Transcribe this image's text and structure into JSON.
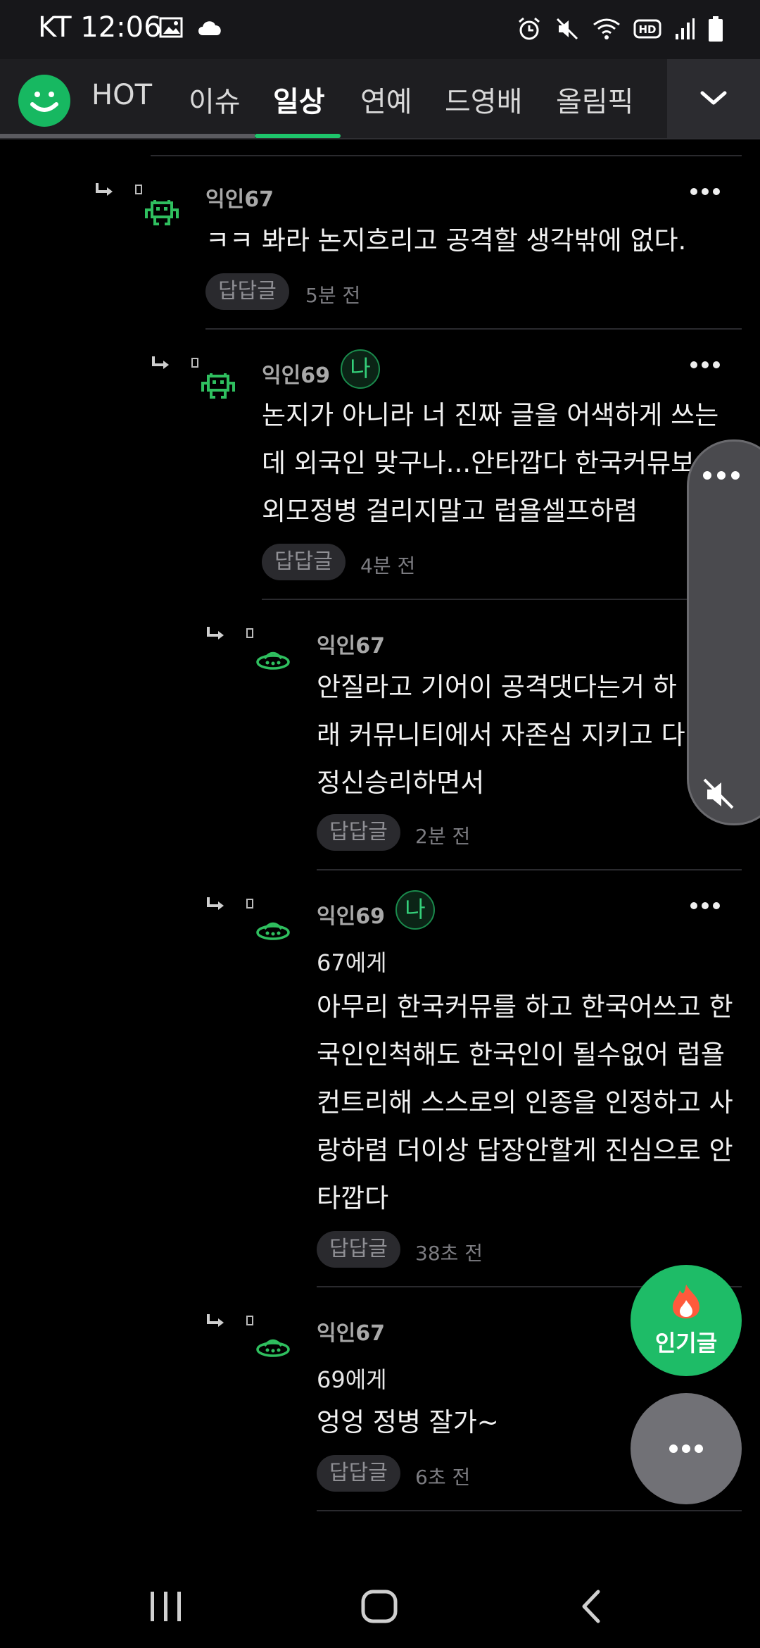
{
  "status_bar": {
    "carrier_time": "KT 12:06",
    "left_icons": [
      "image-icon",
      "cloud-icon"
    ],
    "right_icons": [
      "alarm-icon",
      "mute-icon",
      "wifi-icon",
      "hd-icon",
      "signal-icon",
      "battery-icon"
    ]
  },
  "tabs": {
    "items": [
      {
        "label": "HOT"
      },
      {
        "label": "이슈"
      },
      {
        "label": "일상"
      },
      {
        "label": "연예"
      },
      {
        "label": "드영배"
      },
      {
        "label": "올림픽"
      }
    ],
    "active_index": 2,
    "accent": "#1ec46b"
  },
  "comments": [
    {
      "author": "익인67",
      "is_me": false,
      "reply_to": "",
      "lines": [
        "ㅋㅋ 봐라 논지흐리고 공격할 생각밖에 없다."
      ],
      "reply_label": "답답글",
      "time": "5분 전",
      "avatar": "space-invader-icon"
    },
    {
      "author": "익인69",
      "is_me": true,
      "me_label": "나",
      "reply_to": "",
      "lines": [
        "논지가 아니라 너 진짜 글을 어색하게 쓰는",
        "데 외국인 맞구나...안타깝다 한국커뮤보",
        "외모정병 걸리지말고 럽욜셀프하렴"
      ],
      "reply_label": "답답글",
      "time": "4분 전",
      "avatar": "space-invader-icon"
    },
    {
      "author": "익인67",
      "is_me": false,
      "reply_to": "",
      "lines": [
        "안질라고 기어이 공격댓다는거 하",
        "래 커뮤니티에서 자존심 지키고 다",
        "정신승리하면서"
      ],
      "reply_label": "답답글",
      "time": "2분 전",
      "avatar": "ufo-icon"
    },
    {
      "author": "익인69",
      "is_me": true,
      "me_label": "나",
      "reply_to": "67에게",
      "lines": [
        "아무리 한국커뮤를 하고 한국어쓰고 한",
        "국인인척해도 한국인이 될수없어 럽욜",
        "컨트리해 스스로의 인종을 인정하고 사",
        "랑하렴 더이상 답장안할게 진심으로 안",
        "타깝다"
      ],
      "reply_label": "답답글",
      "time": "38초 전",
      "avatar": "ufo-icon"
    },
    {
      "author": "익인67",
      "is_me": false,
      "reply_to": "69에게",
      "lines": [
        "엉엉 정병 잘가~"
      ],
      "reply_label": "답답글",
      "time": "6초 전",
      "avatar": "ufo-icon"
    }
  ],
  "fab": {
    "hot_label": "인기글"
  },
  "colors": {
    "green": "#1ebc67",
    "avatar_green": "#2fbf5f"
  }
}
